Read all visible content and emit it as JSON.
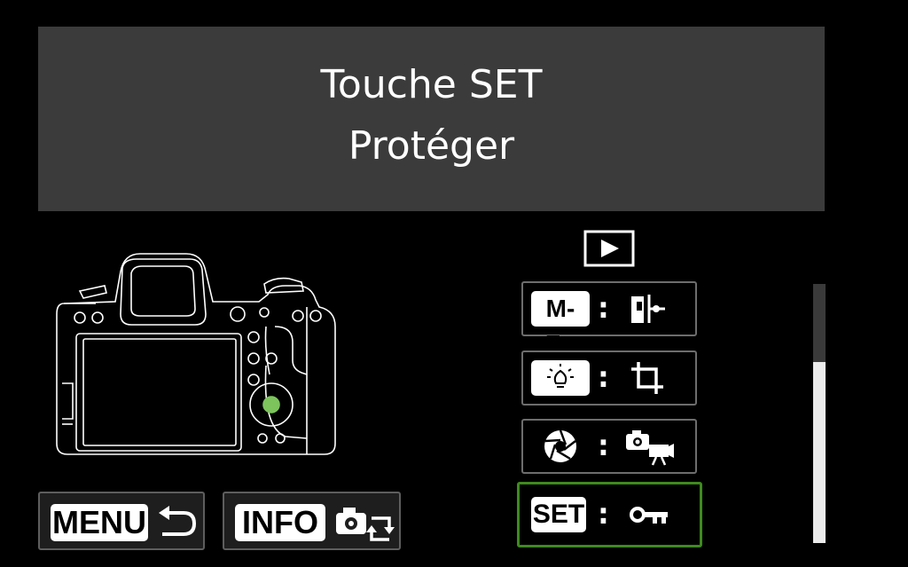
{
  "header": {
    "line1": "Touche SET",
    "line2": "Protéger"
  },
  "mode_icon": "playback-icon",
  "assignments": [
    {
      "source_label": "M-Fn",
      "source_icon": "m-fn-button-icon",
      "target_icon": "rating-icon",
      "selected": false
    },
    {
      "source_label": "",
      "source_icon": "lcd-illumination-button-icon",
      "target_icon": "crop-icon",
      "selected": false
    },
    {
      "source_label": "",
      "source_icon": "aperture-button-icon",
      "target_icon": "photo-movie-switch-icon",
      "selected": false
    },
    {
      "source_label": "SET",
      "source_icon": "set-button-icon",
      "target_icon": "protect-key-icon",
      "selected": true
    }
  ],
  "separator": ":",
  "buttons": {
    "menu_label": "MENU",
    "menu_icon": "return-arrow-icon",
    "info_label": "INFO",
    "info_icon": "camera-rotate-icon"
  },
  "scroll": {
    "position": 0.3,
    "visible_fraction": 0.7
  },
  "colors": {
    "header_bg": "#3b3b3b",
    "selection_border": "#3f8a1f",
    "highlight_dot": "#7dc45c"
  }
}
